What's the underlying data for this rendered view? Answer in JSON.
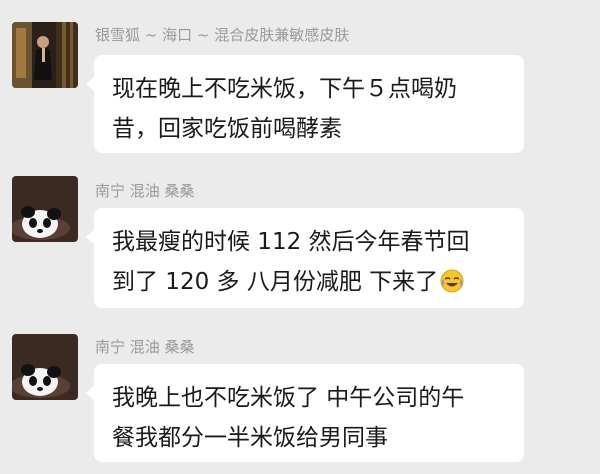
{
  "messages": [
    {
      "sender": "银雪狐 ~ 海口 ~ 混合皮肤兼敏感皮肤",
      "avatar_icon": "person-photo-avatar",
      "lines": [
        "现在晚上不吃米饭，下午５点喝奶",
        "昔，回家吃饭前喝酵素"
      ]
    },
    {
      "sender": "南宁 混油 桑桑",
      "avatar_icon": "panda-avatar",
      "lines": [
        "我最瘦的时候 112 然后今年春节回",
        "到了 120 多  八月份减肥 下来了"
      ],
      "emoji": "crying-laughing-emoji"
    },
    {
      "sender": "南宁 混油 桑桑",
      "avatar_icon": "panda-avatar",
      "lines": [
        "我晚上也不吃米饭了 中午公司的午",
        "餐我都分一半米饭给男同事"
      ]
    }
  ],
  "colors": {
    "background": "#ebebeb",
    "bubble": "#ffffff",
    "sender_text": "#9a9a9a",
    "message_text": "#1a1a1a"
  }
}
